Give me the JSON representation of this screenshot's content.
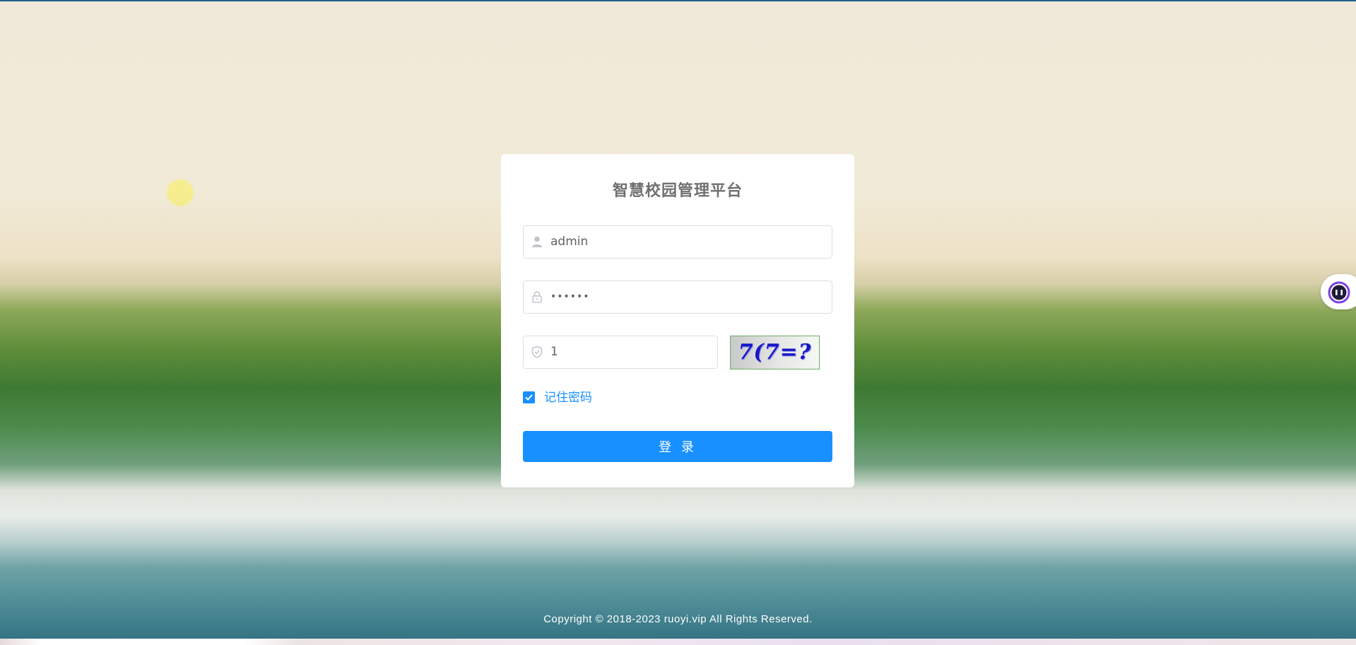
{
  "login": {
    "title": "智慧校园管理平台",
    "username_value": "admin",
    "password_value": "••••••",
    "captcha_value": "1",
    "captcha_image_text": "7(7=?",
    "remember_label": "记住密码",
    "remember_checked": true,
    "login_button_label": "登 录"
  },
  "footer": {
    "copyright": "Copyright © 2018-2023 ruoyi.vip All Rights Reserved."
  },
  "colors": {
    "accent": "#1890ff",
    "title_text": "#707070",
    "input_border": "#dcdfe6",
    "captcha_text": "#1616c8"
  },
  "icons": {
    "username": "user-icon",
    "password": "lock-icon",
    "captcha": "shield-icon",
    "floating": "assistant-face-icon"
  }
}
